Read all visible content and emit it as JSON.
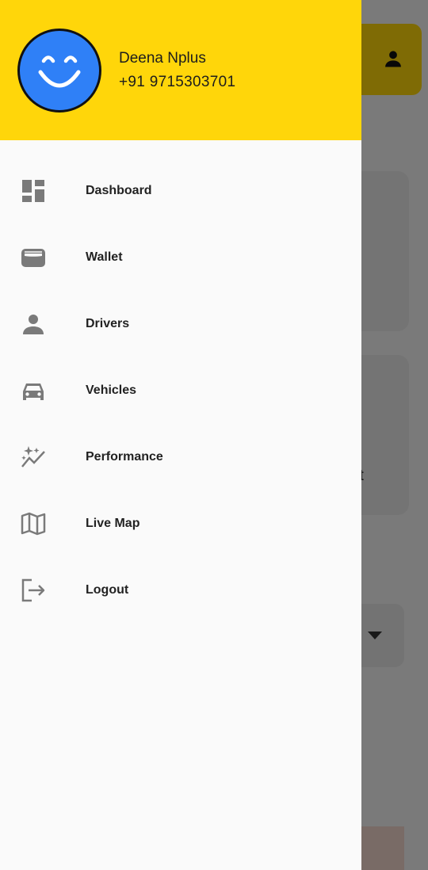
{
  "underlay": {
    "card_text": "nt",
    "profile_icon": "person-icon"
  },
  "drawer": {
    "user": {
      "name": "Deena Nplus",
      "phone": "+91 9715303701",
      "avatar_icon": "smiley-avatar-icon"
    },
    "menu": [
      {
        "label": "Dashboard",
        "icon": "dashboard-icon"
      },
      {
        "label": "Wallet",
        "icon": "wallet-icon"
      },
      {
        "label": "Drivers",
        "icon": "person-icon"
      },
      {
        "label": "Vehicles",
        "icon": "car-icon"
      },
      {
        "label": "Performance",
        "icon": "performance-icon"
      },
      {
        "label": "Live Map",
        "icon": "map-icon"
      },
      {
        "label": "Logout",
        "icon": "logout-icon"
      }
    ]
  },
  "colors": {
    "header_bg": "#ffd60a",
    "avatar_bg": "#2f80f7",
    "icon_gray": "#7a7a7a",
    "drawer_bg": "#fafafa"
  }
}
